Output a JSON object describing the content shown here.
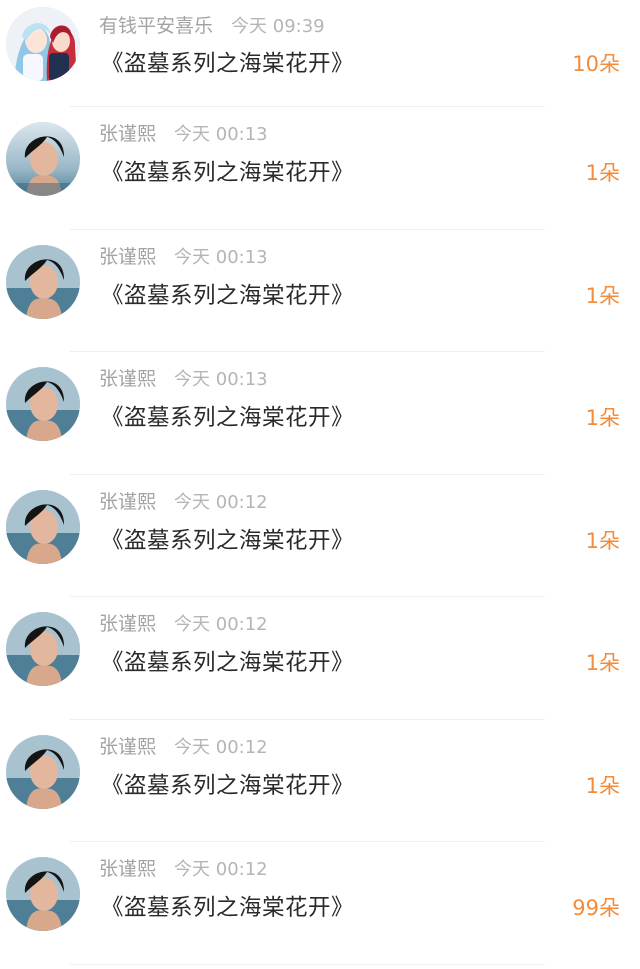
{
  "records": [
    {
      "user": "有钱平安喜乐",
      "time": "今天 09:39",
      "title": "《盗墓系列之海棠花开》",
      "count": "10朵",
      "avatar": "anime-couple-avatar"
    },
    {
      "user": "张谨熙",
      "time": "今天 00:13",
      "title": "《盗墓系列之海棠花开》",
      "count": "1朵",
      "avatar": "boy-portrait-avatar"
    },
    {
      "user": "张谨熙",
      "time": "今天 00:13",
      "title": "《盗墓系列之海棠花开》",
      "count": "1朵",
      "avatar": "boy-portrait-avatar"
    },
    {
      "user": "张谨熙",
      "time": "今天 00:13",
      "title": "《盗墓系列之海棠花开》",
      "count": "1朵",
      "avatar": "boy-portrait-avatar"
    },
    {
      "user": "张谨熙",
      "time": "今天 00:12",
      "title": "《盗墓系列之海棠花开》",
      "count": "1朵",
      "avatar": "boy-portrait-avatar"
    },
    {
      "user": "张谨熙",
      "time": "今天 00:12",
      "title": "《盗墓系列之海棠花开》",
      "count": "1朵",
      "avatar": "boy-portrait-avatar"
    },
    {
      "user": "张谨熙",
      "time": "今天 00:12",
      "title": "《盗墓系列之海棠花开》",
      "count": "1朵",
      "avatar": "boy-portrait-avatar"
    },
    {
      "user": "张谨熙",
      "time": "今天 00:12",
      "title": "《盗墓系列之海棠花开》",
      "count": "99朵",
      "avatar": "boy-portrait-avatar"
    }
  ],
  "colors": {
    "count": "#f28b3a",
    "title": "#2a2a2a",
    "meta": "#a3a3a3",
    "divider": "#efefef"
  }
}
